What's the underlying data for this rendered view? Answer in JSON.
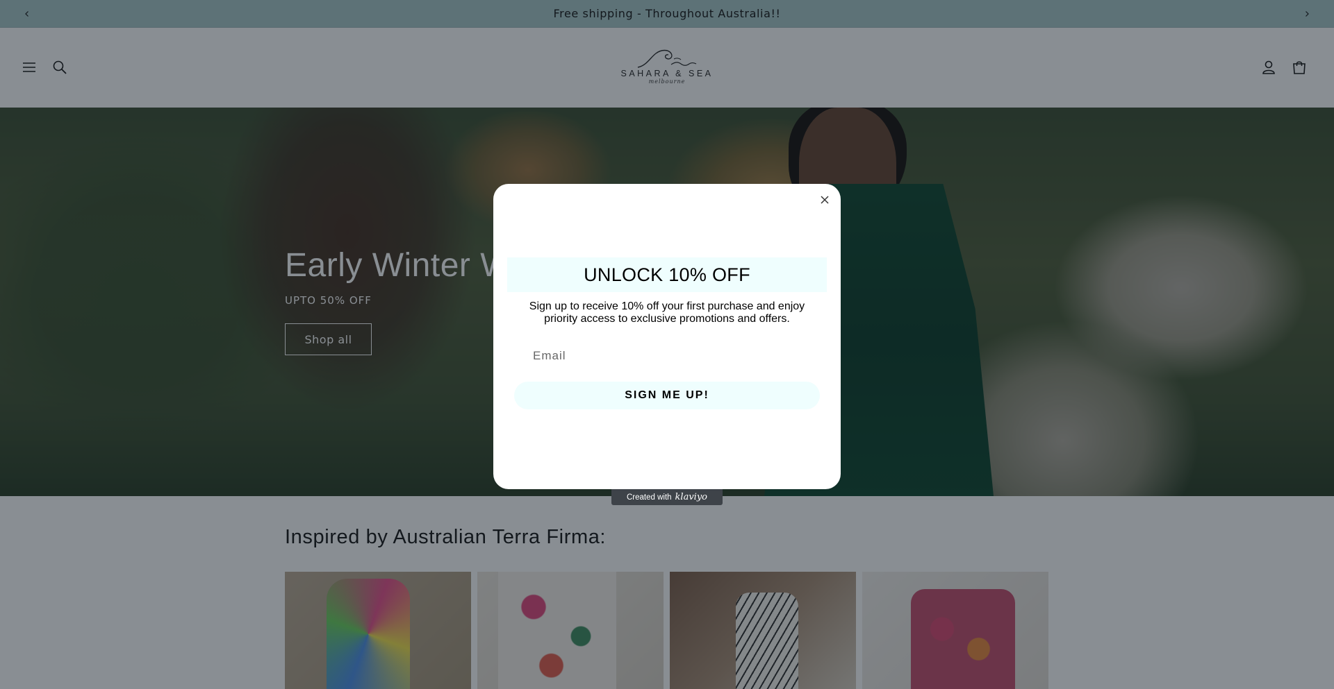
{
  "announcement": {
    "text": "Free shipping - Throughout Australia!!",
    "prev_icon": "chevron-left-icon",
    "next_icon": "chevron-right-icon"
  },
  "header": {
    "logo_brand": "SAHARA & SEA",
    "logo_script": "melbourne",
    "menu_icon": "hamburger-icon",
    "search_icon": "search-icon",
    "account_icon": "user-icon",
    "cart_icon": "cart-icon"
  },
  "hero": {
    "title": "Early Winter W",
    "subtitle": "UPTO 50% OFF",
    "button_label": "Shop all"
  },
  "collection": {
    "title": "Inspired by Australian Terra Firma:",
    "cards": [
      {
        "name": "product-card-1"
      },
      {
        "name": "product-card-2"
      },
      {
        "name": "product-card-3"
      },
      {
        "name": "product-card-4"
      }
    ]
  },
  "popup": {
    "heading": "UNLOCK 10% OFF",
    "body": "Sign up to receive 10% off your first purchase and enjoy priority access to exclusive promotions and offers.",
    "email_placeholder": "Email",
    "email_value": "",
    "submit_label": "SIGN ME UP!",
    "close_icon": "close-icon"
  },
  "badge": {
    "prefix": "Created with",
    "brand": "klaviyo"
  },
  "colors": {
    "announcement_bg": "#a7c6c7",
    "popup_accent": "#effefe",
    "overlay": "rgba(20,30,40,0.5)",
    "dress_green": "#0f5d3c"
  }
}
